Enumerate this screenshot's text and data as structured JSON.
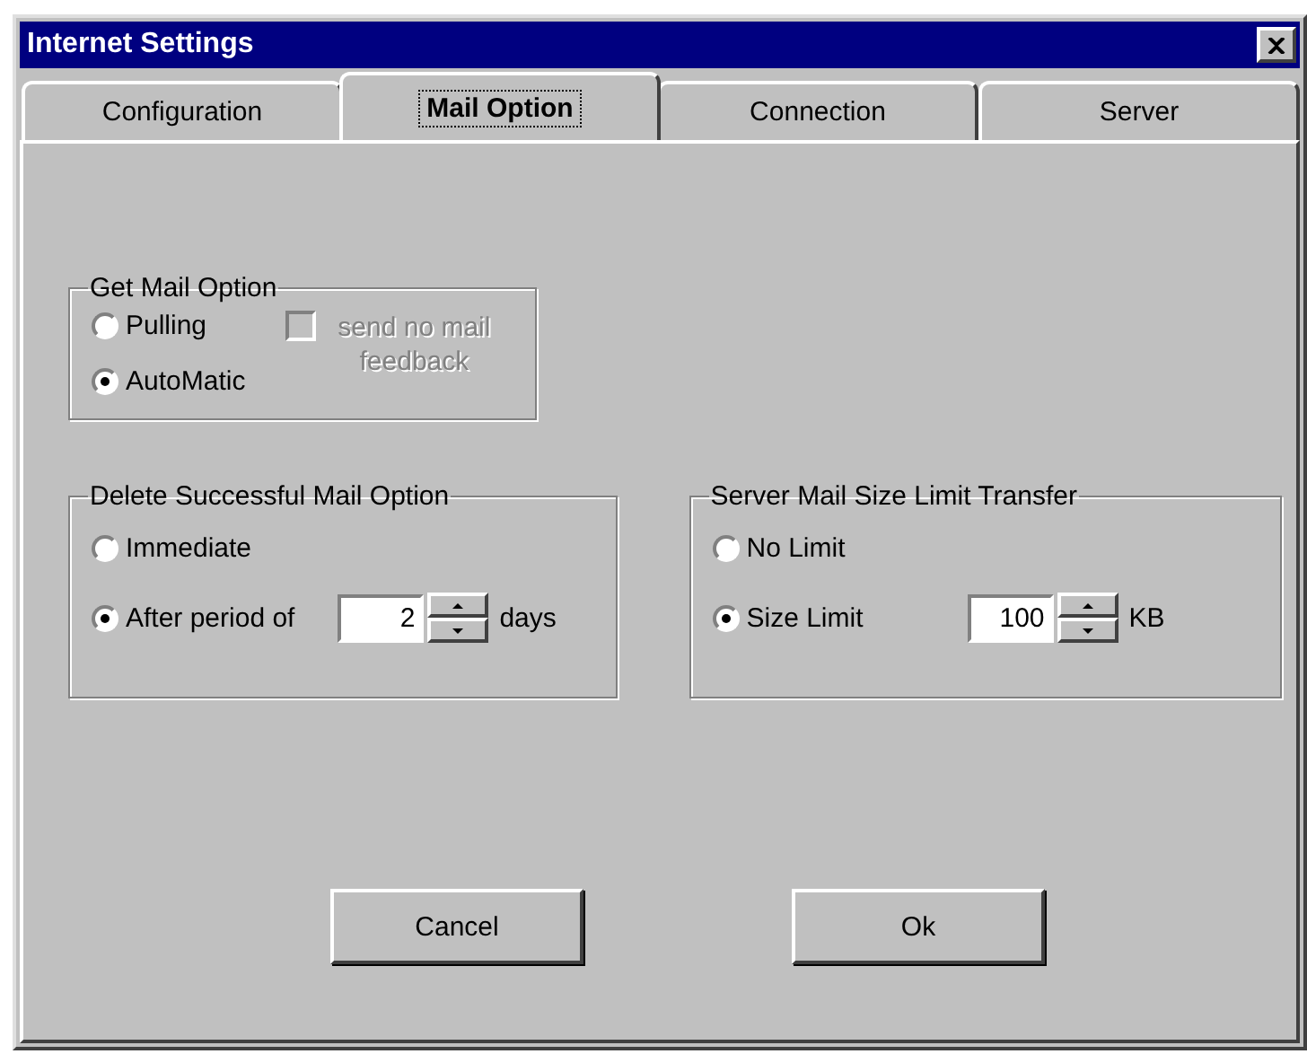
{
  "window": {
    "title": "Internet Settings"
  },
  "tabs": [
    {
      "label": "Configuration",
      "selected": false
    },
    {
      "label": "Mail Option",
      "selected": true
    },
    {
      "label": "Connection",
      "selected": false
    },
    {
      "label": "Server",
      "selected": false
    }
  ],
  "get_mail": {
    "title": "Get Mail Option",
    "options": [
      {
        "label": "Pulling",
        "selected": false
      },
      {
        "label": "AutoMatic",
        "selected": true
      }
    ],
    "checkbox": {
      "label": "send no mail feedback",
      "checked": false,
      "disabled": true
    }
  },
  "delete_mail": {
    "title": "Delete Successful Mail Option",
    "options": [
      {
        "label": "Immediate",
        "selected": false
      },
      {
        "label": "After period of",
        "selected": true
      }
    ],
    "spinner": {
      "value": "2",
      "unit": "days"
    }
  },
  "size_limit": {
    "title": "Server Mail Size Limit Transfer",
    "options": [
      {
        "label": "No Limit",
        "selected": false
      },
      {
        "label": "Size Limit",
        "selected": true
      }
    ],
    "spinner": {
      "value": "100",
      "unit": "KB"
    }
  },
  "buttons": [
    "Cancel",
    "Ok"
  ]
}
